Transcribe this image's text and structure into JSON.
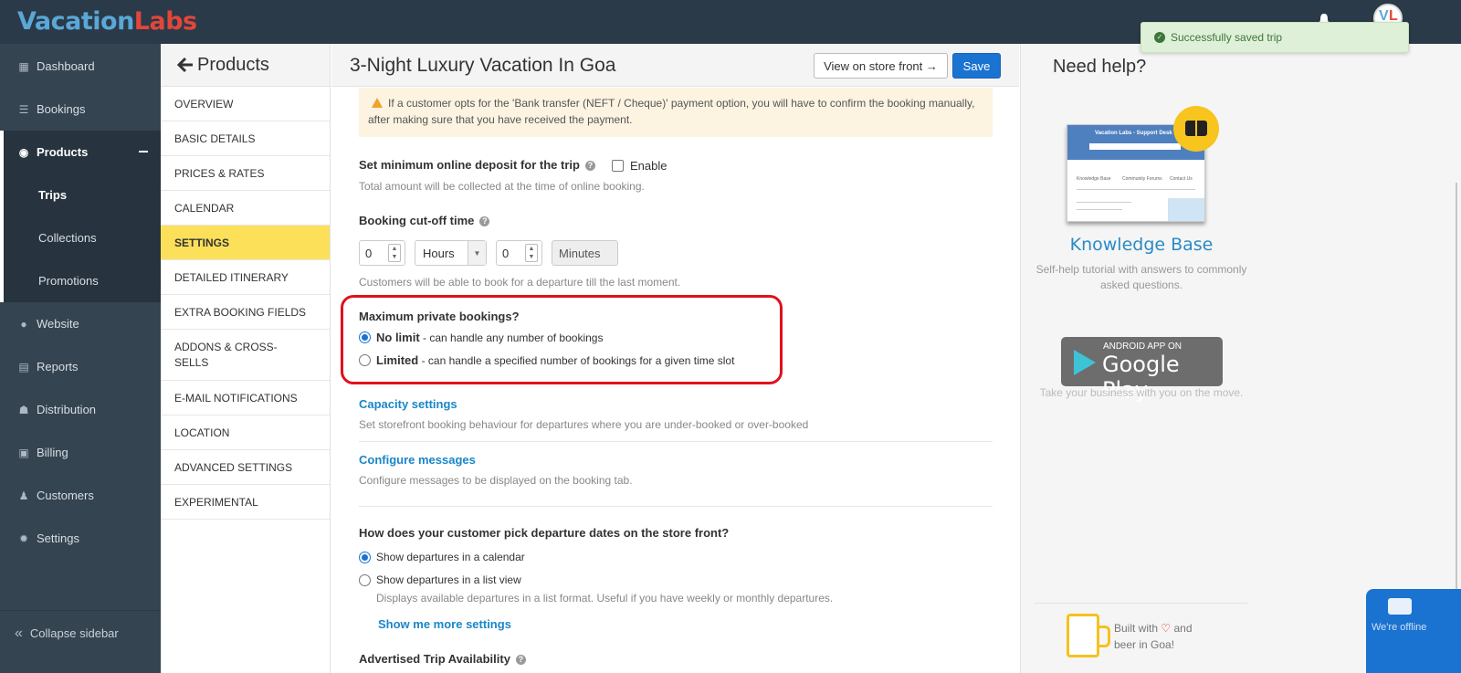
{
  "brand": {
    "part1": "Vacation",
    "part2": "Labs"
  },
  "user": {
    "avatar_v": "V",
    "avatar_l": "L"
  },
  "sidebar": {
    "items": [
      {
        "label": "Dashboard",
        "icon": "tachometer-icon",
        "glyph": "▦"
      },
      {
        "label": "Bookings",
        "icon": "list-icon",
        "glyph": "☰"
      },
      {
        "label": "Products",
        "icon": "lightbulb-icon",
        "glyph": "◉"
      },
      {
        "label": "Trips"
      },
      {
        "label": "Collections"
      },
      {
        "label": "Promotions"
      },
      {
        "label": "Website",
        "icon": "globe-icon",
        "glyph": "●"
      },
      {
        "label": "Reports",
        "icon": "file-icon",
        "glyph": "▤"
      },
      {
        "label": "Distribution",
        "icon": "users-icon",
        "glyph": "☗"
      },
      {
        "label": "Billing",
        "icon": "money-icon",
        "glyph": "▣"
      },
      {
        "label": "Customers",
        "icon": "user-icon",
        "glyph": "♟"
      },
      {
        "label": "Settings",
        "icon": "gear-icon",
        "glyph": "✹"
      }
    ],
    "collapse_label": "Collapse sidebar"
  },
  "subnav": {
    "title": "Products",
    "items": [
      "OVERVIEW",
      "BASIC DETAILS",
      "PRICES & RATES",
      "CALENDAR",
      "SETTINGS",
      "DETAILED ITINERARY",
      "EXTRA BOOKING FIELDS",
      "ADDONS & CROSS-SELLS",
      "E-MAIL NOTIFICATIONS",
      "LOCATION",
      "ADVANCED SETTINGS",
      "EXPERIMENTAL"
    ],
    "active": "SETTINGS"
  },
  "main": {
    "title": "3-Night Luxury Vacation In Goa",
    "view_store_label": "View on store front →",
    "save_label": "Save",
    "warning_text": "If a customer opts for the 'Bank transfer (NEFT / Cheque)' payment option, you will have to confirm the booking manually, after making sure that you have received the payment.",
    "deposit": {
      "label": "Set minimum online deposit for the trip",
      "enable_label": "Enable",
      "enabled": false,
      "hint": "Total amount will be collected at the time of online booking."
    },
    "cutoff": {
      "label": "Booking cut-off time",
      "value1": "0",
      "unit1": "Hours",
      "value2": "0",
      "unit2": "Minutes",
      "hint": "Customers will be able to book for a departure till the last moment."
    },
    "private_bookings": {
      "label": "Maximum private bookings?",
      "options": [
        {
          "title": "No limit",
          "desc": " - can handle any number of bookings",
          "selected": true
        },
        {
          "title": "Limited",
          "desc": " - can handle a specified number of bookings for a given time slot",
          "selected": false
        }
      ]
    },
    "capacity": {
      "link": "Capacity settings",
      "desc": "Set storefront booking behaviour for departures where you are under-booked or over-booked"
    },
    "messages": {
      "link": "Configure messages",
      "desc": "Configure messages to be displayed on the booking tab."
    },
    "departures": {
      "label": "How does your customer pick departure dates on the store front?",
      "options": [
        {
          "text": "Show departures in a calendar",
          "selected": true
        },
        {
          "text": "Show departures in a list view",
          "selected": false,
          "desc": "Displays available departures in a list format. Useful if you have weekly or monthly departures."
        }
      ],
      "more_link": "Show me more settings"
    },
    "next_section": "Advertised Trip Availability"
  },
  "help": {
    "title": "Need help?",
    "kb_thumb_title": "Vacation Labs - Support Desk",
    "kb_thumb_cols": [
      "Knowledge Base",
      "Community Forums",
      "Contact Us"
    ],
    "kb_link": "Knowledge Base",
    "kb_desc": "Self-help tutorial with answers to commonly asked questions.",
    "gp_small": "ANDROID APP ON",
    "gp_big": "Google Play",
    "gp_desc": "Take your business with you on the move.",
    "built_pre": "Built with",
    "built_post": "and",
    "built_line2": "beer in Goa!"
  },
  "toast": {
    "text": "Successfully saved trip"
  },
  "chat": {
    "text": "We're offline"
  },
  "colors": {
    "topbar": "#2b3a48",
    "sidebar": "#354451",
    "active_subnav": "#fce05a",
    "primary": "#1a73d1",
    "link": "#1a86c8",
    "highlight": "#e1101d"
  }
}
